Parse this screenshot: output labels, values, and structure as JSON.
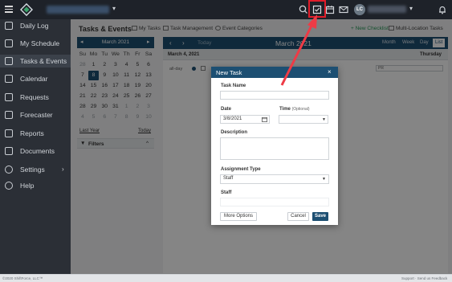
{
  "topbar": {
    "user_initials": "LC",
    "highlight_color": "#e11d2a"
  },
  "sidebar": {
    "items": [
      {
        "label": "Daily Log",
        "icon": "edit-icon"
      },
      {
        "label": "My Schedule",
        "icon": "calendar-icon"
      },
      {
        "label": "Tasks & Events",
        "icon": "checklist-icon"
      },
      {
        "label": "Calendar",
        "icon": "calendar-icon"
      },
      {
        "label": "Requests",
        "icon": "mail-icon"
      },
      {
        "label": "Forecaster",
        "icon": "chart-icon"
      },
      {
        "label": "Reports",
        "icon": "report-icon"
      },
      {
        "label": "Documents",
        "icon": "folder-icon"
      },
      {
        "label": "Settings",
        "icon": "gear-icon"
      },
      {
        "label": "Help",
        "icon": "help-icon"
      }
    ]
  },
  "page": {
    "title": "Tasks & Events",
    "links": {
      "my_tasks": "My Tasks",
      "task_management": "Task Management",
      "event_categories": "Event Categories",
      "new_checklist": "+ New Checklist",
      "multi_location": "Multi-Location Tasks"
    }
  },
  "mini_calendar": {
    "month": "March 2021",
    "dow": [
      "Su",
      "Mo",
      "Tu",
      "We",
      "Th",
      "Fr",
      "Sa"
    ],
    "weeks": [
      [
        "28",
        "1",
        "2",
        "3",
        "4",
        "5",
        "6"
      ],
      [
        "7",
        "8",
        "9",
        "10",
        "11",
        "12",
        "13"
      ],
      [
        "14",
        "15",
        "16",
        "17",
        "18",
        "19",
        "20"
      ],
      [
        "21",
        "22",
        "23",
        "24",
        "25",
        "26",
        "27"
      ],
      [
        "28",
        "29",
        "30",
        "31",
        "1",
        "2",
        "3"
      ],
      [
        "4",
        "5",
        "6",
        "7",
        "8",
        "9",
        "10"
      ]
    ],
    "last_year": "Last Year",
    "today": "Today",
    "filters": "Filters"
  },
  "main_calendar": {
    "today": "Today",
    "title": "March 2021",
    "views": [
      "Month",
      "Week",
      "Day",
      "List"
    ],
    "active_view": "List",
    "day_label": "March 4, 2021",
    "day_name": "Thursday",
    "all_day": "all-day",
    "field_text": "PR"
  },
  "modal": {
    "title": "New Task",
    "close": "×",
    "task_name_label": "Task Name",
    "date_label": "Date",
    "date_value": "3/8/2021",
    "time_label": "Time",
    "time_optional": "(Optional)",
    "description_label": "Description",
    "assignment_type_label": "Assignment Type",
    "assignment_type_value": "Staff",
    "staff_label": "Staff",
    "more_options": "More Options",
    "cancel": "Cancel",
    "save": "Save"
  },
  "footer": {
    "copyright": "©2020 ShiftForce, LLC™",
    "links": "Support · Send us Feedback"
  },
  "colors": {
    "accent": "#1d4f72",
    "topbar": "#1e2229",
    "sidebar": "#2b2f36",
    "annotation": "#e11d2a"
  }
}
